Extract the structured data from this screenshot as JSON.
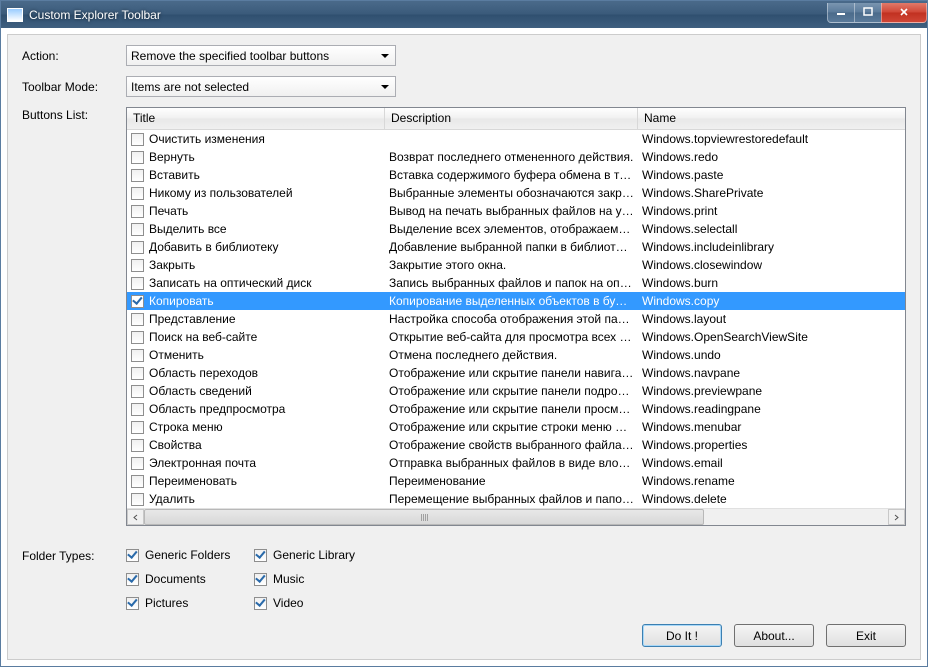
{
  "window": {
    "title": "Custom Explorer Toolbar"
  },
  "labels": {
    "action": "Action:",
    "toolbar_mode": "Toolbar Mode:",
    "buttons_list": "Buttons List:",
    "folder_types": "Folder Types:"
  },
  "dropdowns": {
    "action": "Remove the specified toolbar buttons",
    "mode": "Items are not selected"
  },
  "columns": {
    "title": "Title",
    "description": "Description",
    "name": "Name"
  },
  "rows": [
    {
      "title": "Очистить изменения",
      "desc": "",
      "name": "Windows.topviewrestoredefault",
      "checked": false
    },
    {
      "title": "Вернуть",
      "desc": "Возврат последнего отмененного действия.",
      "name": "Windows.redo",
      "checked": false
    },
    {
      "title": "Вставить",
      "desc": "Вставка содержимого буфера обмена в тек...",
      "name": "Windows.paste",
      "checked": false
    },
    {
      "title": "Никому из пользователей",
      "desc": "Выбранные элементы обозначаются закрыт...",
      "name": "Windows.SharePrivate",
      "checked": false
    },
    {
      "title": "Печать",
      "desc": "Вывод на печать выбранных файлов на ука...",
      "name": "Windows.print",
      "checked": false
    },
    {
      "title": "Выделить все",
      "desc": "Выделение всех элементов, отображаемых ...",
      "name": "Windows.selectall",
      "checked": false
    },
    {
      "title": "Добавить в библиотеку",
      "desc": "Добавление выбранной папки в библиотеку.",
      "name": "Windows.includeinlibrary",
      "checked": false
    },
    {
      "title": "Закрыть",
      "desc": "Закрытие этого окна.",
      "name": "Windows.closewindow",
      "checked": false
    },
    {
      "title": "Записать на оптический диск",
      "desc": "Запись выбранных файлов и папок на опти...",
      "name": "Windows.burn",
      "checked": false
    },
    {
      "title": "Копировать",
      "desc": "Копирование выделенных объектов в буфе...",
      "name": "Windows.copy",
      "checked": true,
      "selected": true
    },
    {
      "title": "Представление",
      "desc": "Настройка способа отображения этой папки.",
      "name": "Windows.layout",
      "checked": false
    },
    {
      "title": "Поиск на веб-сайте",
      "desc": "Открытие веб-сайта для просмотра всех ре...",
      "name": "Windows.OpenSearchViewSite",
      "checked": false
    },
    {
      "title": "Отменить",
      "desc": "Отмена последнего действия.",
      "name": "Windows.undo",
      "checked": false
    },
    {
      "title": "Область переходов",
      "desc": "Отображение или скрытие панели навигации.",
      "name": "Windows.navpane",
      "checked": false
    },
    {
      "title": "Область сведений",
      "desc": "Отображение или скрытие панели подробн...",
      "name": "Windows.previewpane",
      "checked": false
    },
    {
      "title": "Область предпросмотра",
      "desc": "Отображение или скрытие панели просмотра.",
      "name": "Windows.readingpane",
      "checked": false
    },
    {
      "title": "Строка меню",
      "desc": "Отображение или скрытие строки меню дл...",
      "name": "Windows.menubar",
      "checked": false
    },
    {
      "title": "Свойства",
      "desc": "Отображение свойств выбранного файла и...",
      "name": "Windows.properties",
      "checked": false
    },
    {
      "title": "Электронная почта",
      "desc": "Отправка выбранных файлов в виде вложе...",
      "name": "Windows.email",
      "checked": false
    },
    {
      "title": "Переименовать",
      "desc": "Переименование",
      "name": "Windows.rename",
      "checked": false
    },
    {
      "title": "Удалить",
      "desc": "Перемещение выбранных файлов и папок в ...",
      "name": "Windows.delete",
      "checked": false
    }
  ],
  "folder_types": [
    {
      "label": "Generic Folders",
      "checked": true
    },
    {
      "label": "Generic Library",
      "checked": true
    },
    {
      "label": "Documents",
      "checked": true
    },
    {
      "label": "Music",
      "checked": true
    },
    {
      "label": "Pictures",
      "checked": true
    },
    {
      "label": "Video",
      "checked": true
    }
  ],
  "buttons": {
    "do_it": "Do It !",
    "about": "About...",
    "exit": "Exit"
  }
}
